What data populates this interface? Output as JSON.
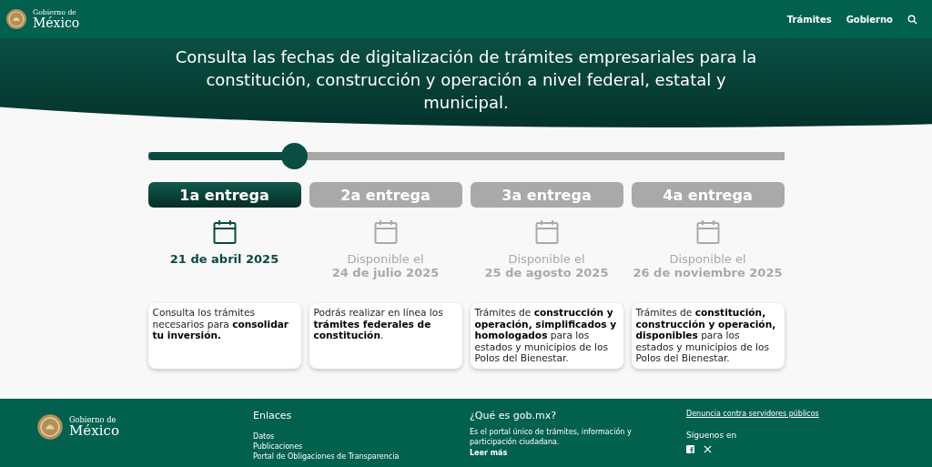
{
  "header": {
    "logo_small": "Gobierno de",
    "logo_big": "México",
    "nav": [
      "Trámites",
      "Gobierno"
    ]
  },
  "hero": {
    "text": "Consulta las fechas de digitalización de trámites empresariales para la constitución, construcción y operación a nivel federal, estatal y municipal."
  },
  "slider": {
    "level": 0.23
  },
  "entregas": [
    {
      "label": "1a entrega",
      "selected": true,
      "date": "21 de abril 2025",
      "description": "Consulta los trámites necesarios para **consolidar tu inversión.**"
    },
    {
      "label": "2a entrega",
      "selected": false,
      "prefix": "Disponible el",
      "date": "24 de julio 2025",
      "description": "Podrás realizar en línea los **trámites federales de constitución**."
    },
    {
      "label": "3a entrega",
      "selected": false,
      "prefix": "Disponible el",
      "date": "25 de agosto 2025",
      "description": "Trámites de **construcción y operación, simplificados y homologados** para los estados y municipios de los Polos del Bienestar."
    },
    {
      "label": "4a entrega",
      "selected": false,
      "prefix": "Disponible el",
      "date": "26 de noviembre 2025",
      "description": "Trámites de **constitución, construcción y operación, disponibles** para los estados y municipios de los Polos del Bienestar."
    }
  ],
  "footer": {
    "logo_small": "Gobierno de",
    "logo_big": "México",
    "links_title": "Enlaces",
    "links": [
      "Datos",
      "Publicaciones",
      "Portal de Obligaciones de Transparencia"
    ],
    "about_title": "¿Qué es gob.mx?",
    "about_text": "Es el portal único de trámites, información y participación ciudadana.",
    "about_link": "Leer más",
    "report_link": "Denuncia contra servidores públicos",
    "follow": "Síguenos en"
  }
}
